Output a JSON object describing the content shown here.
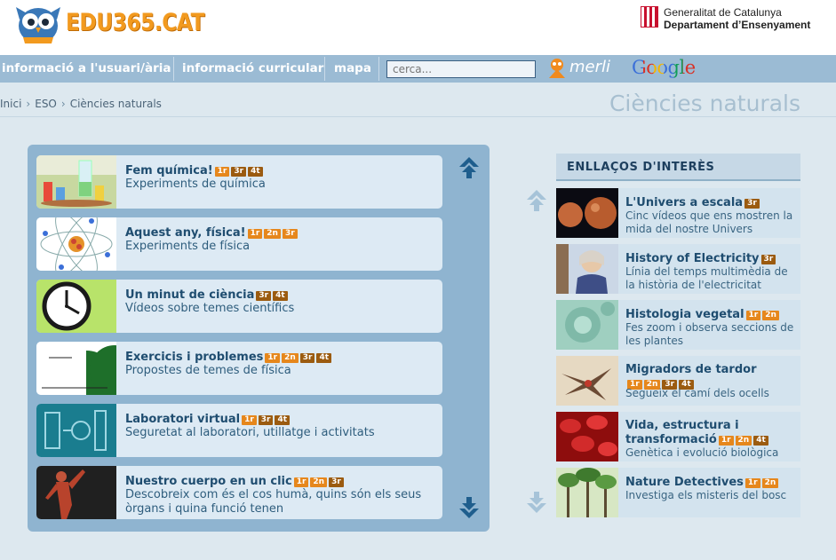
{
  "header": {
    "logo_text": "EDU365.CAT",
    "gencat_line1": "Generalitat de Catalunya",
    "gencat_line2": "Departament d’Ensenyament"
  },
  "nav": {
    "items": [
      {
        "label": "informació a l'usuari/ària"
      },
      {
        "label": "informació curricular"
      },
      {
        "label": "mapa"
      }
    ],
    "search_placeholder": "cerca...",
    "merli_label": "merli",
    "google_label": "Google"
  },
  "breadcrumb": [
    "Inici",
    "ESO",
    "Ciències naturals"
  ],
  "page_title": "Ciències naturals",
  "resources": [
    {
      "title": "Fem química!",
      "badges": [
        "1r",
        "3r",
        "4t"
      ],
      "desc": "Experiments de química"
    },
    {
      "title": "Aquest any, física!",
      "badges": [
        "1r",
        "2n",
        "3r"
      ],
      "desc": "Experiments de física"
    },
    {
      "title": "Un minut de ciència",
      "badges": [
        "3r",
        "4t"
      ],
      "desc": "Vídeos sobre temes científics"
    },
    {
      "title": "Exercicis i problemes",
      "badges": [
        "1r",
        "2n",
        "3r",
        "4t"
      ],
      "desc": "Propostes de temes de física"
    },
    {
      "title": "Laboratori virtual",
      "badges": [
        "1r",
        "3r",
        "4t"
      ],
      "desc": "Seguretat al laboratori, utillatge i activitats"
    },
    {
      "title": "Nuestro cuerpo en un clic",
      "badges": [
        "1r",
        "2n",
        "3r"
      ],
      "desc": "Descobreix com és el cos humà, quins són els seus òrgans i quina funció tenen"
    }
  ],
  "links": {
    "header": "ENLLAÇOS D'INTERÈS",
    "items": [
      {
        "title": "L'Univers a escala",
        "badges": [
          "3r"
        ],
        "desc": "Cinc vídeos que ens mostren la mida del nostre Univers"
      },
      {
        "title": "History of Electricity",
        "badges": [
          "3r"
        ],
        "desc": "Línia del temps multimèdia de la història de l'electricitat"
      },
      {
        "title": "Histologia vegetal",
        "badges": [
          "1r",
          "2n"
        ],
        "desc": "Fes zoom i observa seccions de les plantes"
      },
      {
        "title": "Migradors de tardor",
        "badges": [
          "1r",
          "2n",
          "3r",
          "4t"
        ],
        "desc": "Segueix el camí dels ocells"
      },
      {
        "title": "Vida, estructura i transformació",
        "badges": [
          "1r",
          "2n",
          "4t"
        ],
        "desc": "Genètica i evolució biològica"
      },
      {
        "title": "Nature Detectives",
        "badges": [
          "1r",
          "2n"
        ],
        "desc": "Investiga els misteris del bosc"
      }
    ]
  },
  "colors": {
    "badge_orange": "#e6871c",
    "badge_brown": "#9b5b10",
    "nav_bg": "#9bbbd4",
    "panel_bg": "#8fb4d0"
  }
}
